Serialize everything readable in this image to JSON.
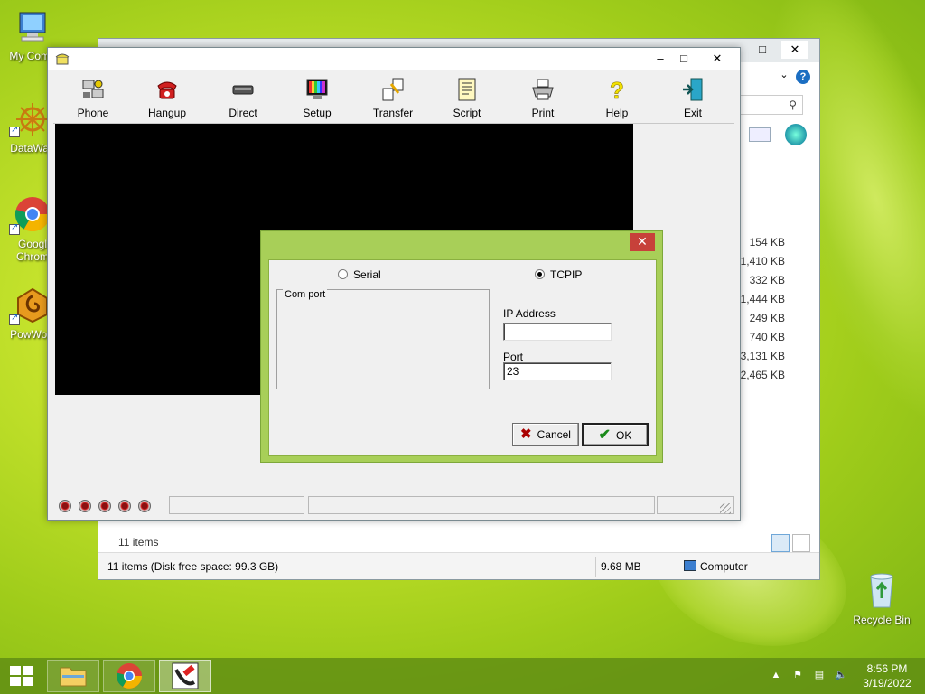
{
  "desktop": {
    "icons": [
      {
        "label": "My Comp",
        "icon": "computer-icon"
      },
      {
        "label": "DataWag",
        "icon": "datawagon-icon"
      },
      {
        "label": "Googl",
        "label2": "Chrom",
        "icon": "chrome-icon"
      },
      {
        "label": "PowWow",
        "icon": "powwow-icon"
      },
      {
        "label": "Recycle Bin",
        "icon": "recycle-bin-icon"
      }
    ]
  },
  "explorer": {
    "file_sizes": [
      "154 KB",
      "1,410 KB",
      "332 KB",
      "1,444 KB",
      "249 KB",
      "740 KB",
      "3,131 KB",
      "2,465 KB"
    ],
    "items_count": "11 items",
    "status_text": "11 items (Disk free space: 99.3 GB)",
    "status_size": "9.68 MB",
    "status_location": "Computer",
    "help": "?"
  },
  "terminal": {
    "toolbar": [
      {
        "label": "Phone",
        "icon": "phone-icon"
      },
      {
        "label": "Hangup",
        "icon": "hangup-icon"
      },
      {
        "label": "Direct",
        "icon": "direct-icon"
      },
      {
        "label": "Setup",
        "icon": "setup-icon"
      },
      {
        "label": "Transfer",
        "icon": "transfer-icon"
      },
      {
        "label": "Script",
        "icon": "script-icon"
      },
      {
        "label": "Print",
        "icon": "print-icon"
      },
      {
        "label": "Help",
        "icon": "help-icon"
      },
      {
        "label": "Exit",
        "icon": "exit-icon"
      }
    ],
    "window_controls": {
      "minimize": "–",
      "maximize": "□",
      "close": "✕"
    }
  },
  "dialog": {
    "close": "✕",
    "serial_label": "Serial",
    "tcpip_label": "TCPIP",
    "selected_connection": "TCPIP",
    "com_port_label": "Com port",
    "ip_address_label": "IP Address",
    "ip_address_value": "",
    "port_label": "Port",
    "port_value": "23",
    "cancel_label": "Cancel",
    "ok_label": "OK"
  },
  "taskbar": {
    "time": "8:56 PM",
    "date": "3/19/2022"
  },
  "colors": {
    "dialog_frame": "#a8cf58",
    "close_red": "#c7413a",
    "taskbar": "#5f8c14"
  }
}
